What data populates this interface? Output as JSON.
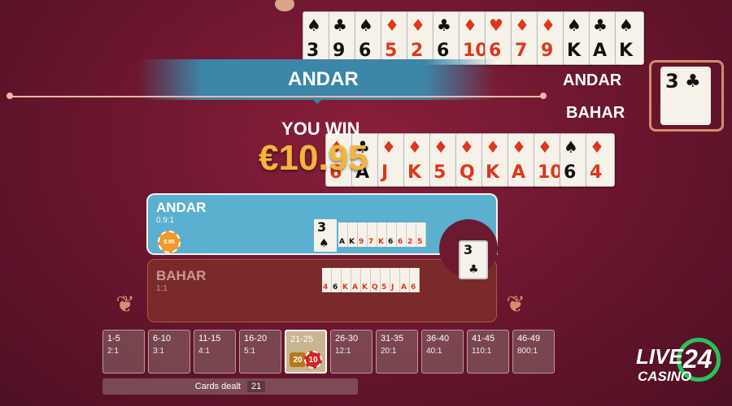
{
  "result": {
    "banner": "ANDAR",
    "side_label_andar": "ANDAR",
    "side_label_bahar": "BAHAR",
    "you_win": "YOU WIN",
    "amount": "€10.95"
  },
  "andar_row_cards": [
    {
      "rank": "3",
      "suit": "♠",
      "color": "black"
    },
    {
      "rank": "9",
      "suit": "♣",
      "color": "black"
    },
    {
      "rank": "6",
      "suit": "♠",
      "color": "black"
    },
    {
      "rank": "5",
      "suit": "♦",
      "color": "red"
    },
    {
      "rank": "2",
      "suit": "♦",
      "color": "red"
    },
    {
      "rank": "6",
      "suit": "♣",
      "color": "black"
    },
    {
      "rank": "10",
      "suit": "♦",
      "color": "red"
    },
    {
      "rank": "6",
      "suit": "♥",
      "color": "red"
    },
    {
      "rank": "7",
      "suit": "♦",
      "color": "red"
    },
    {
      "rank": "9",
      "suit": "♦",
      "color": "red"
    },
    {
      "rank": "K",
      "suit": "♠",
      "color": "black"
    },
    {
      "rank": "A",
      "suit": "♣",
      "color": "black"
    },
    {
      "rank": "K",
      "suit": "♠",
      "color": "black"
    }
  ],
  "bahar_row_cards": [
    {
      "rank": "6",
      "suit": "♦",
      "color": "red"
    },
    {
      "rank": "A",
      "suit": "♣",
      "color": "black"
    },
    {
      "rank": "J",
      "suit": "♦",
      "color": "red"
    },
    {
      "rank": "K",
      "suit": "♦",
      "color": "red"
    },
    {
      "rank": "5",
      "suit": "♦",
      "color": "red"
    },
    {
      "rank": "Q",
      "suit": "♦",
      "color": "red"
    },
    {
      "rank": "K",
      "suit": "♦",
      "color": "red"
    },
    {
      "rank": "A",
      "suit": "♦",
      "color": "red"
    },
    {
      "rank": "10",
      "suit": "♦",
      "color": "red"
    },
    {
      "rank": "6",
      "suit": "♠",
      "color": "black"
    },
    {
      "rank": "4",
      "suit": "♦",
      "color": "red"
    }
  ],
  "joker_card": {
    "rank": "3",
    "suit": "♣"
  },
  "panel": {
    "andar": {
      "title": "ANDAR",
      "odds": "0.9:1",
      "chip": "0.95",
      "cards": "AK97K6625",
      "first_card_rank": "3",
      "first_card_suit": "♠"
    },
    "bahar": {
      "title": "BAHAR",
      "odds": "1:1",
      "cards": "46KAKQ5JA6",
      "last_rank": "6"
    },
    "joker": {
      "rank": "3",
      "suit": "♣"
    }
  },
  "side_bets": [
    {
      "label": "1-5",
      "odds": "2:1"
    },
    {
      "label": "6-10",
      "odds": "3:1"
    },
    {
      "label": "11-15",
      "odds": "4:1"
    },
    {
      "label": "16-20",
      "odds": "5:1"
    },
    {
      "label": "21-25",
      "odds": "",
      "active": true,
      "chip_a": "20",
      "chip_b": "10"
    },
    {
      "label": "26-30",
      "odds": "12:1"
    },
    {
      "label": "31-35",
      "odds": "20:1"
    },
    {
      "label": "36-40",
      "odds": "40:1"
    },
    {
      "label": "41-45",
      "odds": "110:1"
    },
    {
      "label": "46-49",
      "odds": "800:1"
    }
  ],
  "cards_dealt": {
    "label": "Cards dealt",
    "count": "21"
  },
  "logo": {
    "live": "LIVE",
    "casino": "CASINO",
    "number": "24"
  },
  "colors": {
    "andar_blue": "#5bb0cf",
    "gold": "#f3b53a",
    "bahar_panel": "#7a2a2a",
    "table": "#6e1730"
  }
}
